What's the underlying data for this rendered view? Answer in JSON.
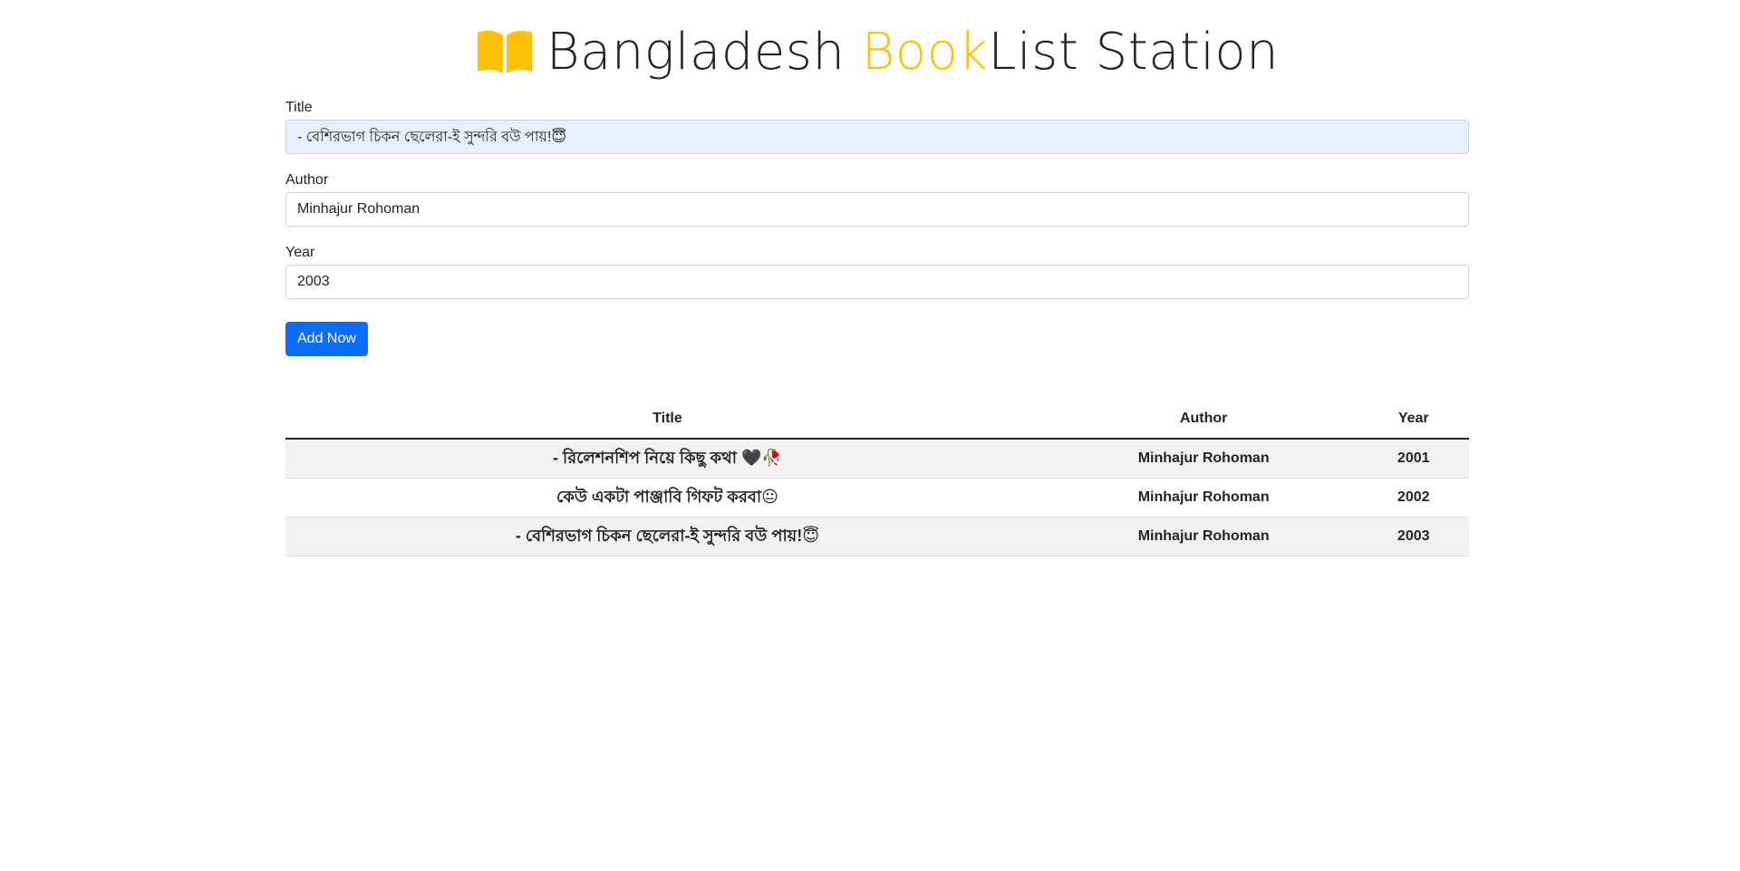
{
  "header": {
    "title_part1": "Bangladesh ",
    "title_accent": "Book",
    "title_part2": "List Station",
    "icon": "open-book-icon",
    "accent_color": "#ffc107"
  },
  "form": {
    "title_label": "Title",
    "title_value": "- বেশিরভাগ চিকন ছেলেরা-ই সুন্দরি বউ পায়!😇",
    "author_label": "Author",
    "author_value": "Minhajur Rohoman",
    "year_label": "Year",
    "year_value": "2003",
    "submit_label": "Add Now",
    "submit_color": "#0d6efd"
  },
  "table": {
    "headers": {
      "title": "Title",
      "author": "Author",
      "year": "Year"
    },
    "rows": [
      {
        "title": "- রিলেশনশিপ নিয়ে কিছু কথা 🖤🥀",
        "author": "Minhajur Rohoman",
        "year": "2001"
      },
      {
        "title": "কেউ একটা পাঞ্জাবি গিফট করবা😐",
        "author": "Minhajur Rohoman",
        "year": "2002"
      },
      {
        "title": "- বেশিরভাগ চিকন ছেলেরা-ই সুন্দরি বউ পায়!😇",
        "author": "Minhajur Rohoman",
        "year": "2003"
      }
    ]
  }
}
